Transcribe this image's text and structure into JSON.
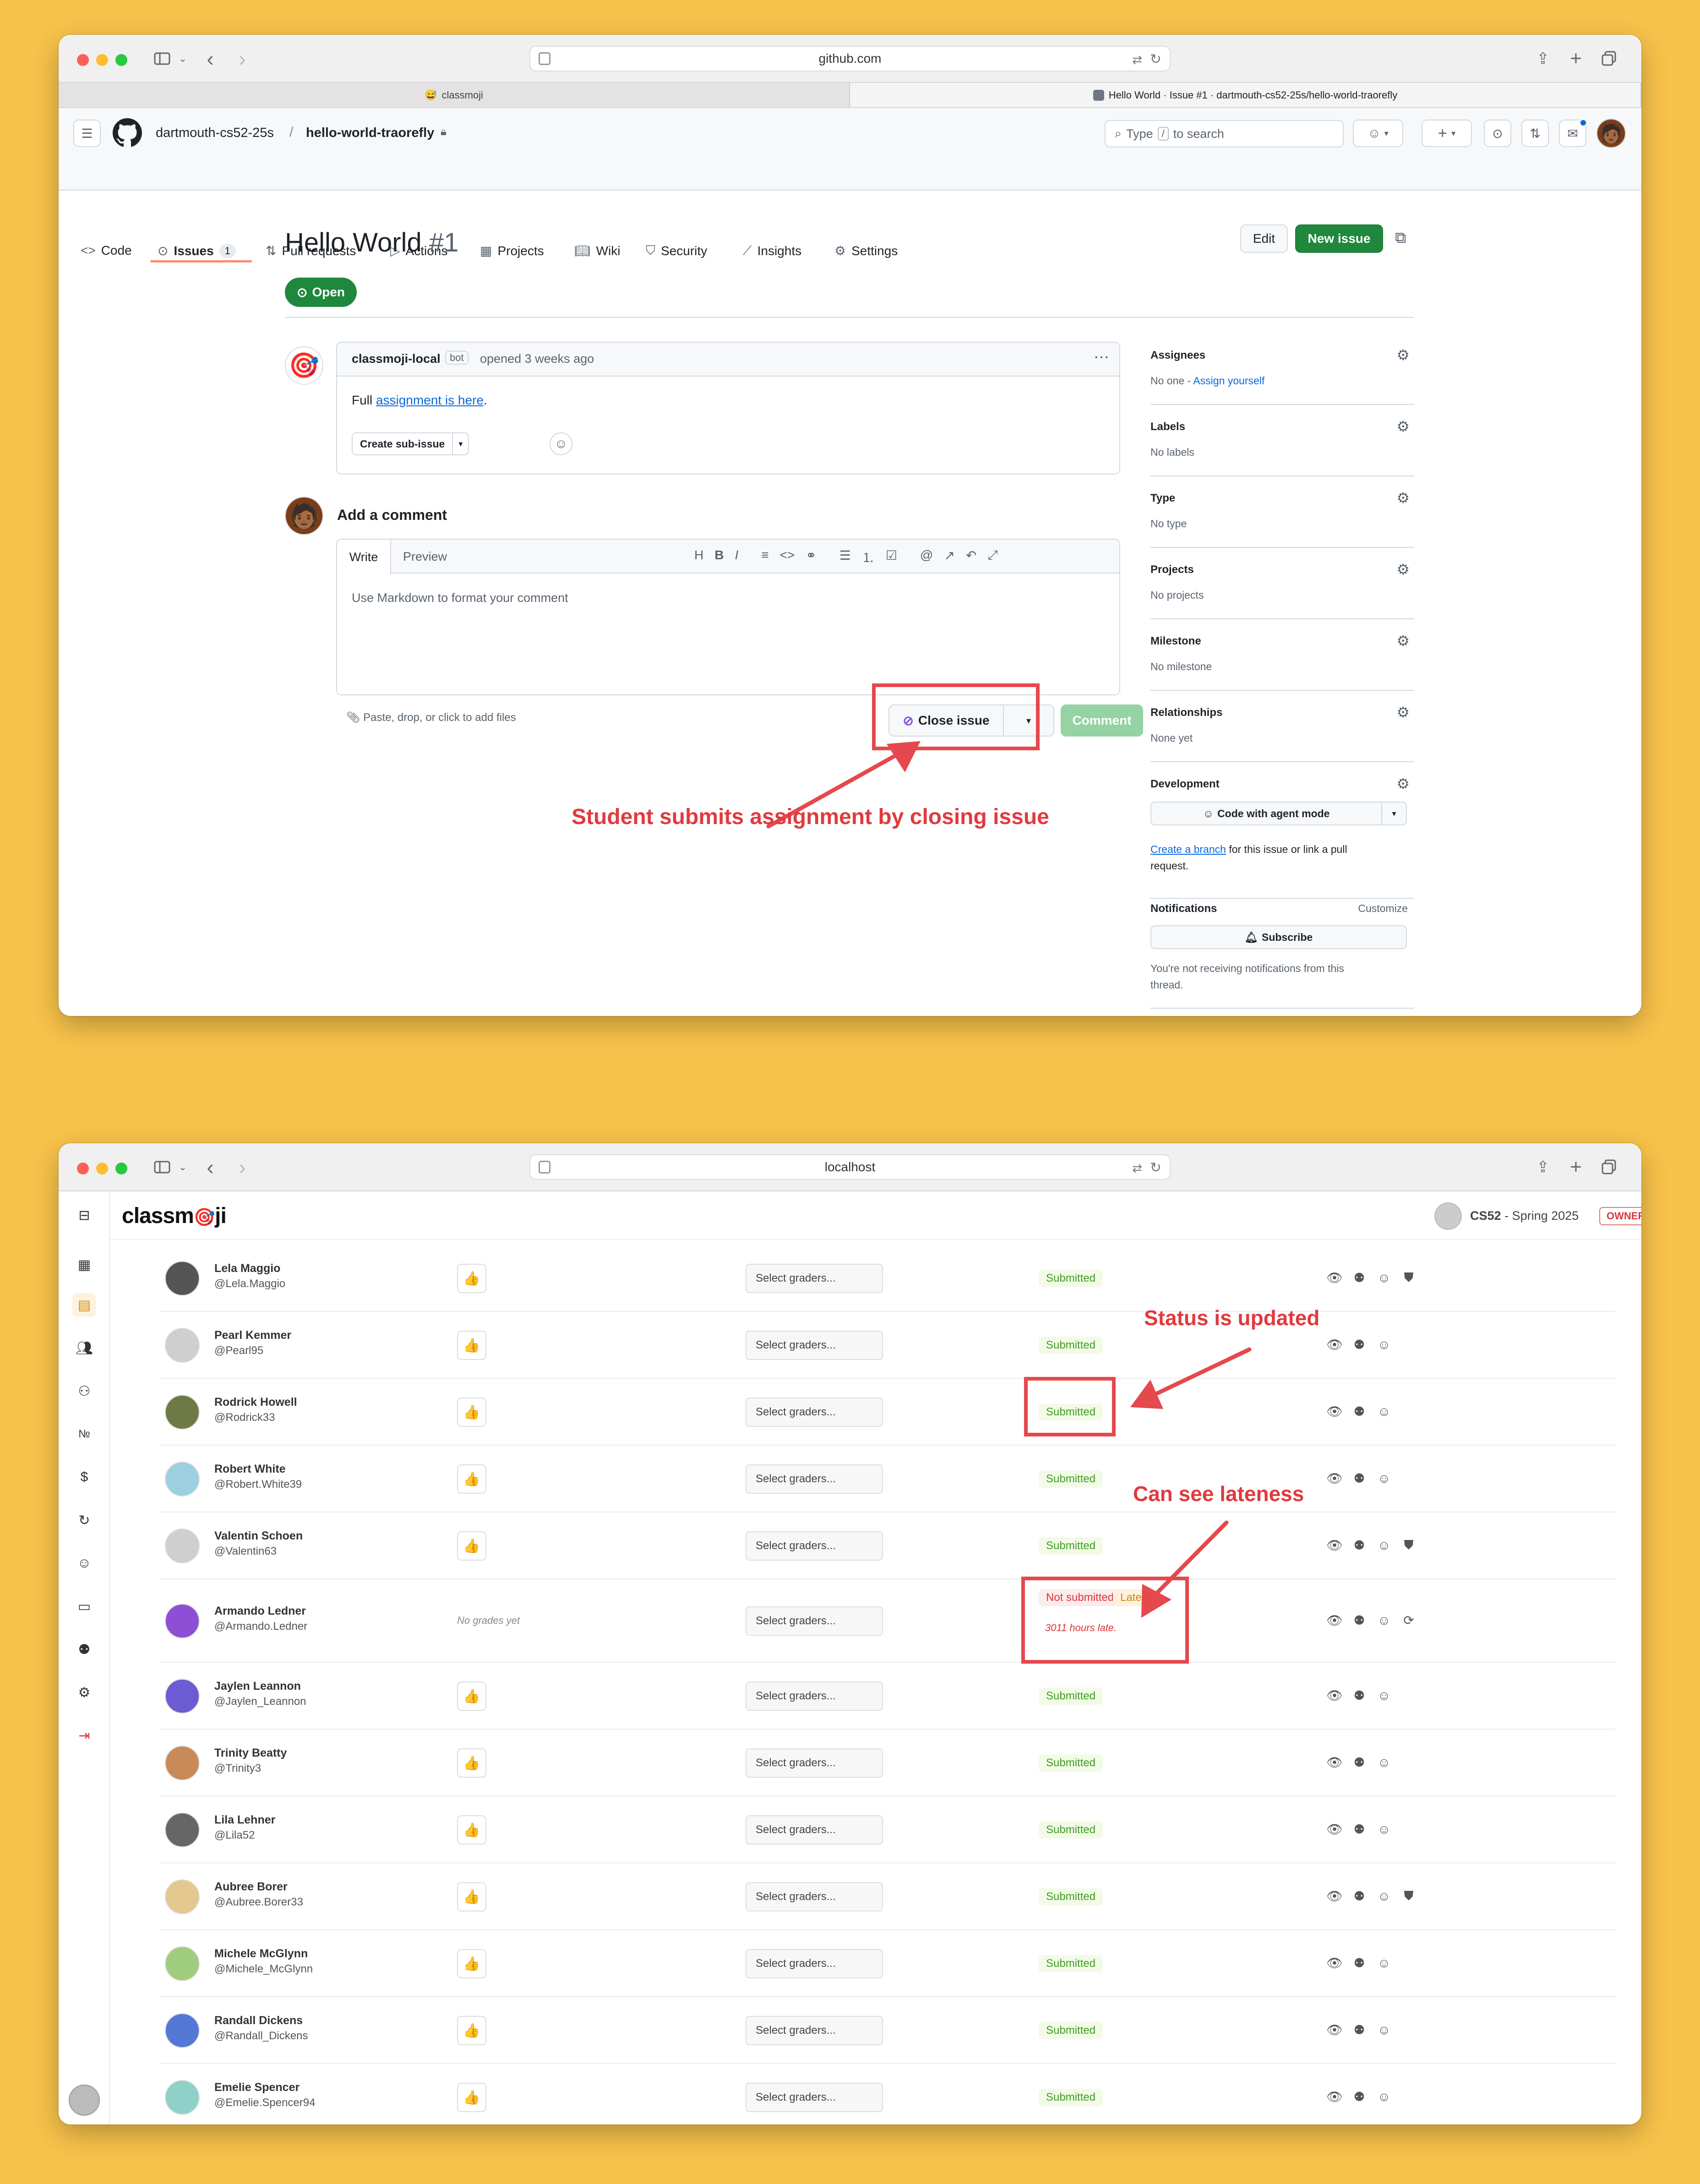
{
  "window1": {
    "url": "github.com",
    "tabs": [
      {
        "title": "classmoji",
        "active": false
      },
      {
        "title": "Hello World · Issue #1 · dartmouth-cs52-25s/hello-world-traorefly",
        "active": true
      }
    ],
    "org": "dartmouth-cs52-25s",
    "repo": "hello-world-traorefly",
    "search_prefix": "Type",
    "search_key": "/",
    "search_suffix": "to search",
    "nav": [
      {
        "label": "Code",
        "icon": "code-icon"
      },
      {
        "label": "Issues",
        "icon": "issue-icon",
        "count": "1",
        "active": true
      },
      {
        "label": "Pull requests",
        "icon": "pull-request-icon"
      },
      {
        "label": "Actions",
        "icon": "play-icon"
      },
      {
        "label": "Projects",
        "icon": "table-icon"
      },
      {
        "label": "Wiki",
        "icon": "book-icon"
      },
      {
        "label": "Security",
        "icon": "shield-icon"
      },
      {
        "label": "Insights",
        "icon": "graph-icon"
      },
      {
        "label": "Settings",
        "icon": "gear-icon"
      }
    ],
    "issue": {
      "title": "Hello World",
      "number": "#1",
      "state": "Open",
      "edit_label": "Edit",
      "new_issue_label": "New issue",
      "author": "classmoji-local",
      "author_badge": "bot",
      "opened": "opened 3 weeks ago",
      "body_prefix": "Full",
      "body_link": "assignment is here",
      "body_suffix": ".",
      "create_sub_issue": "Create sub-issue"
    },
    "comment": {
      "heading": "Add a comment",
      "tab_write": "Write",
      "tab_preview": "Preview",
      "placeholder": "Use Markdown to format your comment",
      "attach_hint": "Paste, drop, or click to add files",
      "close_issue_label": "Close issue",
      "comment_label": "Comment"
    },
    "sidebar": {
      "assignees": {
        "label": "Assignees",
        "value_prefix": "No one -",
        "value_link": "Assign yourself"
      },
      "labels": {
        "label": "Labels",
        "value": "No labels"
      },
      "type": {
        "label": "Type",
        "value": "No type"
      },
      "projects": {
        "label": "Projects",
        "value": "No projects"
      },
      "milestone": {
        "label": "Milestone",
        "value": "No milestone"
      },
      "relationships": {
        "label": "Relationships",
        "value": "None yet"
      },
      "development": {
        "label": "Development",
        "button": "Code with agent mode",
        "link": "Create a branch",
        "text_line1": "for this issue or link a pull",
        "text_line2": "request."
      },
      "notifications": {
        "label": "Notifications",
        "customize": "Customize",
        "subscribe": "Subscribe",
        "text_line1": "You're not receiving notifications from this",
        "text_line2": "thread."
      }
    },
    "annotation": "Student submits assignment by closing issue"
  },
  "window2": {
    "url": "localhost",
    "logo_prefix": "classm",
    "logo_suffix": "ji",
    "course_code": "CS52",
    "course_term": "- Spring 2025",
    "role_badge": "OWNER",
    "grader_placeholder": "Select graders...",
    "thumb_icon": "👍",
    "annotations": {
      "status": "Status is updated",
      "late": "Can see lateness"
    },
    "colors": {
      "submitted_bg": "#f3fbe8",
      "submitted_text": "#3f9d22",
      "not_submitted_text": "#d9363e",
      "late_text": "#d4880f",
      "annotation": "#e03a3e"
    },
    "students": [
      {
        "name": "Lela Maggio",
        "username": "@Lela.Maggio",
        "status": "Submitted",
        "shield": true
      },
      {
        "name": "Pearl Kemmer",
        "username": "@Pearl95",
        "status": "Submitted",
        "shield": false
      },
      {
        "name": "Rodrick Howell",
        "username": "@Rodrick33",
        "status": "Submitted",
        "shield": false
      },
      {
        "name": "Robert White",
        "username": "@Robert.White39",
        "status": "Submitted",
        "shield": false
      },
      {
        "name": "Valentin Schoen",
        "username": "@Valentin63",
        "status": "Submitted",
        "shield": true
      },
      {
        "name": "Armando Ledner",
        "username": "@Armando.Ledner",
        "status": "Not submitted",
        "grade": "No grades yet",
        "late": "Late",
        "late_note": "3011 hours late."
      },
      {
        "name": "Jaylen Leannon",
        "username": "@Jaylen_Leannon",
        "status": "Submitted",
        "shield": false
      },
      {
        "name": "Trinity Beatty",
        "username": "@Trinity3",
        "status": "Submitted",
        "shield": false
      },
      {
        "name": "Lila Lehner",
        "username": "@Lila52",
        "status": "Submitted",
        "shield": false
      },
      {
        "name": "Aubree Borer",
        "username": "@Aubree.Borer33",
        "status": "Submitted",
        "shield": true
      },
      {
        "name": "Michele McGlynn",
        "username": "@Michele_McGlynn",
        "status": "Submitted",
        "shield": false
      },
      {
        "name": "Randall Dickens",
        "username": "@Randall_Dickens",
        "status": "Submitted",
        "shield": false
      },
      {
        "name": "Emelie Spencer",
        "username": "@Emelie.Spencer94",
        "status": "Submitted",
        "shield": false
      }
    ]
  }
}
